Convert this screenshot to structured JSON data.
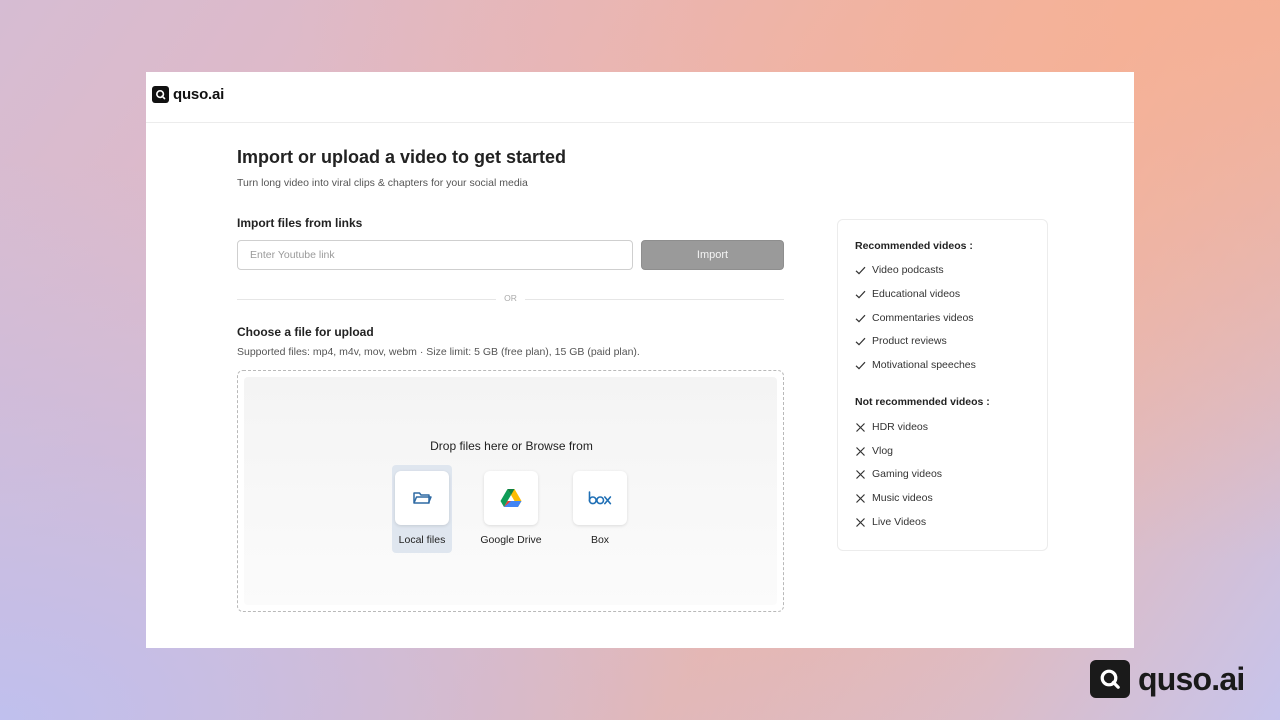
{
  "app": {
    "logo_text": "quso.ai",
    "brand_text": "quso.ai"
  },
  "main": {
    "title": "Import or upload a video to get started",
    "subtitle": "Turn long video into viral clips & chapters for your social media"
  },
  "import_links": {
    "heading": "Import files from links",
    "placeholder": "Enter Youtube link",
    "value": "",
    "button_label": "Import"
  },
  "divider": {
    "or_label": "OR"
  },
  "upload": {
    "heading": "Choose a file for upload",
    "supported": "Supported files: mp4, m4v, mov, webm  ·  Size limit: 5 GB (free plan), 15 GB (paid plan).",
    "drop_text": "Drop files here or Browse from",
    "sources": [
      {
        "label": "Local files",
        "icon": "folder-icon",
        "selected": true
      },
      {
        "label": "Google Drive",
        "icon": "google-drive-icon",
        "selected": false
      },
      {
        "label": "Box",
        "icon": "box-icon",
        "selected": false
      }
    ]
  },
  "recommendations": {
    "recommended_heading": "Recommended videos :",
    "recommended": [
      "Video podcasts",
      "Educational videos",
      "Commentaries videos",
      "Product reviews",
      "Motivational speeches"
    ],
    "not_recommended_heading": "Not recommended videos :",
    "not_recommended": [
      "HDR videos",
      "Vlog",
      "Gaming videos",
      "Music videos",
      "Live Videos"
    ]
  },
  "colors": {
    "import_button_bg": "#9a9a9a",
    "selected_source_bg": "#dfe6ef",
    "folder_icon": "#2f6aa3",
    "box_icon": "#1f6fb5"
  }
}
